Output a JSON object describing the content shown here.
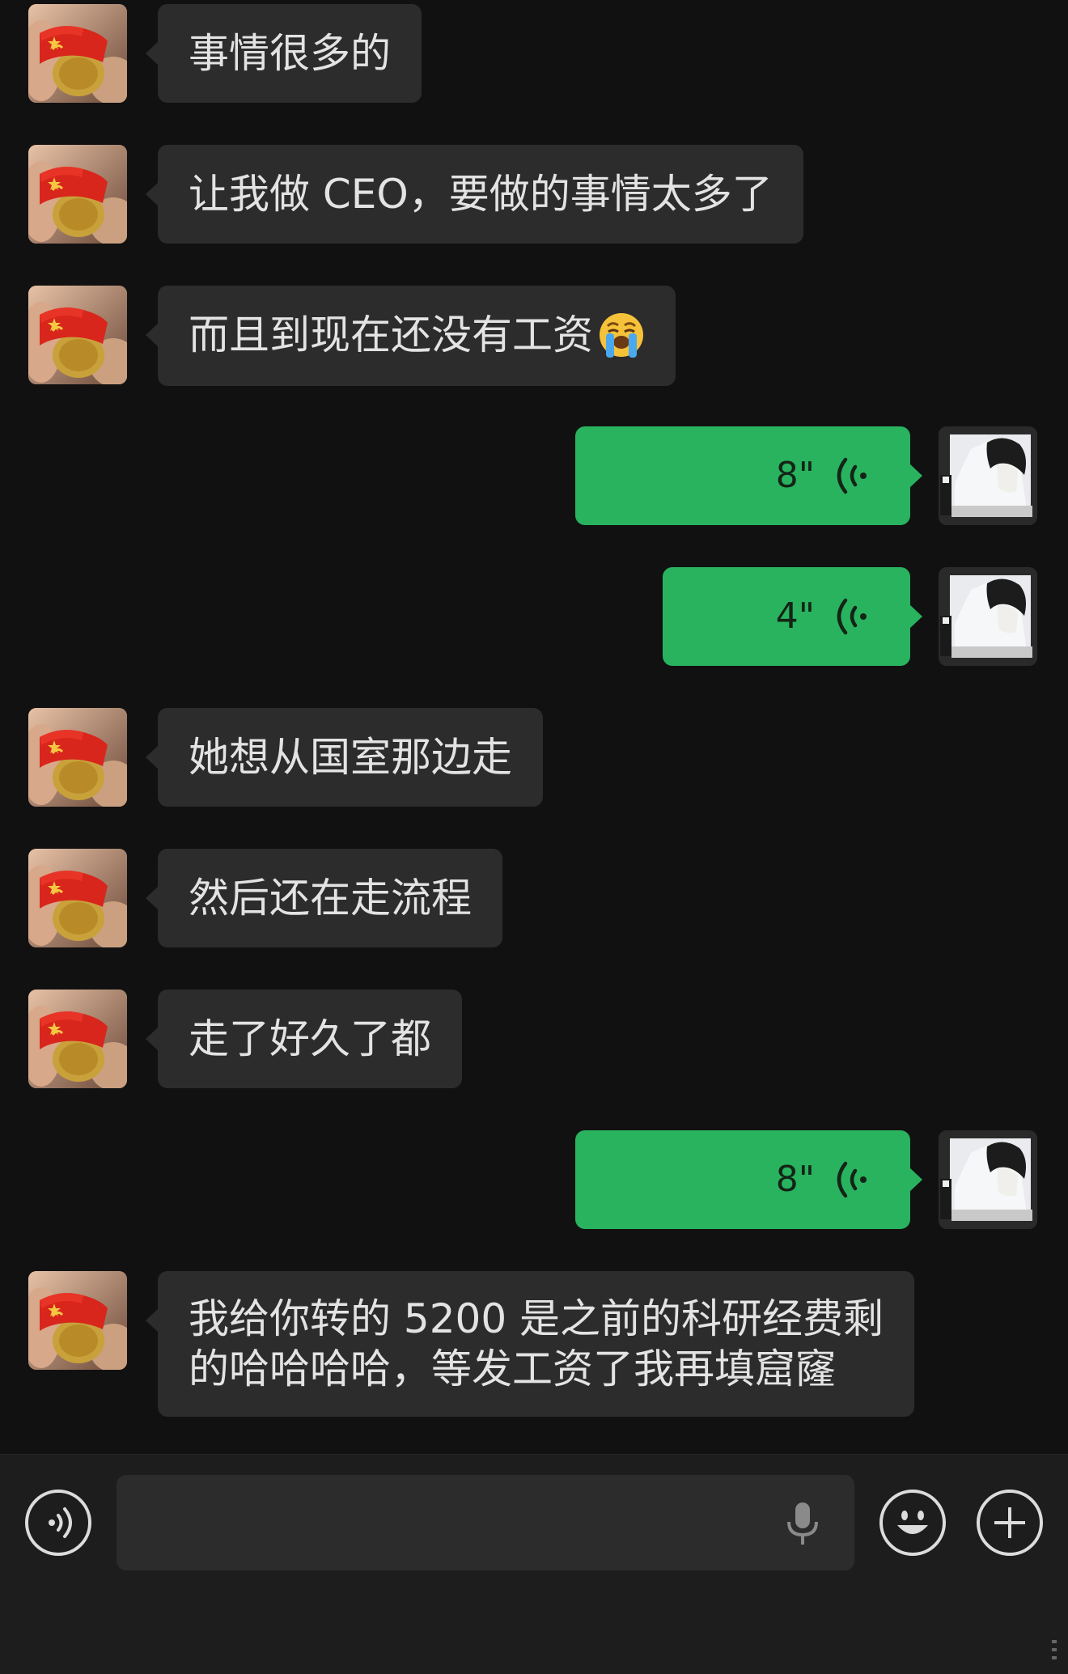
{
  "messages": [
    {
      "type": "text",
      "from": "them",
      "text": "事情很多的"
    },
    {
      "type": "text",
      "from": "them",
      "text": "让我做 CEO，要做的事情太多了"
    },
    {
      "type": "text",
      "from": "them",
      "text": "而且到现在还没有工资",
      "emoji": "loudly-crying-face"
    },
    {
      "type": "voice",
      "from": "me",
      "duration": "8\""
    },
    {
      "type": "voice",
      "from": "me",
      "duration": "4\""
    },
    {
      "type": "text",
      "from": "them",
      "text": "她想从国室那边走"
    },
    {
      "type": "text",
      "from": "them",
      "text": "然后还在走流程"
    },
    {
      "type": "text",
      "from": "them",
      "text": "走了好久了都"
    },
    {
      "type": "voice",
      "from": "me",
      "duration": "8\""
    },
    {
      "type": "text",
      "from": "them",
      "line1": "我给你转的 5200 是之前的科研经费剩",
      "line2": "的哈哈哈哈，等发工资了我再填窟窿"
    }
  ],
  "input_bar": {
    "voice_button_icon": "voice-toggle-icon",
    "text_value": "",
    "mic_icon": "microphone-icon",
    "emoji_button_icon": "smiley-icon",
    "more_button_icon": "plus-icon"
  },
  "colors": {
    "background": "#111111",
    "incoming_bubble": "#2c2c2c",
    "outgoing_bubble": "#29b35f",
    "input_bar": "#1d1d1d"
  }
}
